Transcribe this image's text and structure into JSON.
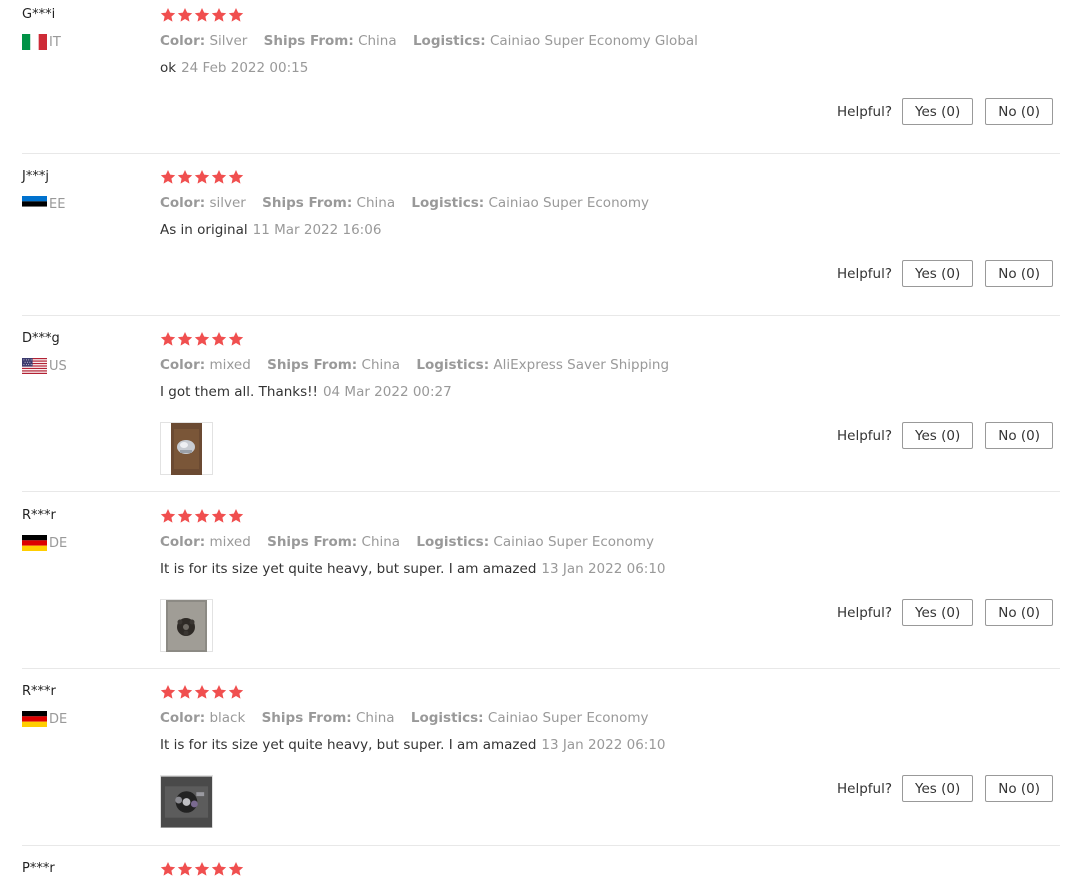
{
  "helpful_label": "Helpful?",
  "star_color": "#f04f4f",
  "labels": {
    "color": "Color:",
    "ships_from": "Ships From:",
    "logistics": "Logistics:"
  },
  "reviews": [
    {
      "user": "G***i",
      "country": "IT",
      "flag": "italy-flag",
      "rating": 5,
      "color": "Silver",
      "ships_from": "China",
      "logistics": "Cainiao Super Economy Global",
      "text": "ok",
      "date": "24 Feb 2022 00:15",
      "yes": "Yes (0)",
      "no": "No (0)",
      "has_photo": false
    },
    {
      "user": "J***j",
      "country": "EE",
      "flag": "estonia-flag",
      "rating": 5,
      "color": "silver",
      "ships_from": "China",
      "logistics": "Cainiao Super Economy",
      "text": "As in original",
      "date": "11 Mar 2022 16:06",
      "yes": "Yes (0)",
      "no": "No (0)",
      "has_photo": false
    },
    {
      "user": "D***g",
      "country": "US",
      "flag": "usa-flag",
      "rating": 5,
      "color": "mixed",
      "ships_from": "China",
      "logistics": "AliExpress Saver Shipping",
      "text": "I got them all. Thanks!!",
      "date": "04 Mar 2022 00:27",
      "yes": "Yes (0)",
      "no": "No (0)",
      "has_photo": true
    },
    {
      "user": "R***r",
      "country": "DE",
      "flag": "germany-flag",
      "rating": 5,
      "color": "mixed",
      "ships_from": "China",
      "logistics": "Cainiao Super Economy",
      "text": "It is for its size yet quite heavy, but super. I am amazed",
      "date": "13 Jan 2022 06:10",
      "yes": "Yes (0)",
      "no": "No (0)",
      "has_photo": true
    },
    {
      "user": "R***r",
      "country": "DE",
      "flag": "germany-flag",
      "rating": 5,
      "color": "black",
      "ships_from": "China",
      "logistics": "Cainiao Super Economy",
      "text": "It is for its size yet quite heavy, but super. I am amazed",
      "date": "13 Jan 2022 06:10",
      "yes": "Yes (0)",
      "no": "No (0)",
      "has_photo": true
    },
    {
      "user": "P***r",
      "rating": 5
    }
  ]
}
